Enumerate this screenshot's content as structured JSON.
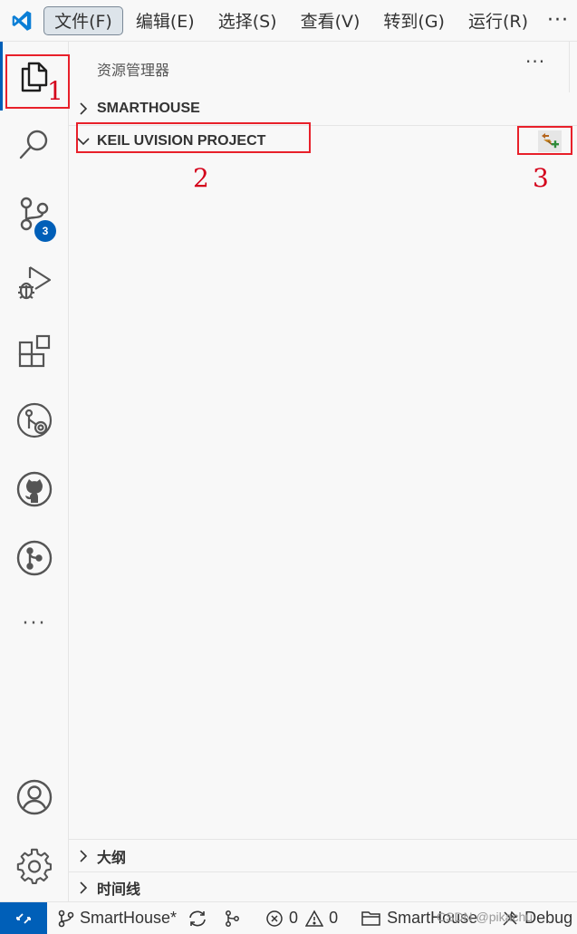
{
  "menubar": {
    "items": [
      {
        "label": "文件(F)",
        "active": true
      },
      {
        "label": "编辑(E)"
      },
      {
        "label": "选择(S)"
      },
      {
        "label": "查看(V)"
      },
      {
        "label": "转到(G)"
      },
      {
        "label": "运行(R)"
      }
    ],
    "more": "···"
  },
  "activitybar": {
    "items": [
      {
        "icon": "explorer-icon",
        "selected": true
      },
      {
        "icon": "search-icon"
      },
      {
        "icon": "source-control-icon",
        "badge": "3"
      },
      {
        "icon": "run-debug-icon"
      },
      {
        "icon": "extensions-icon"
      },
      {
        "icon": "git-graph-icon"
      },
      {
        "icon": "github-icon"
      },
      {
        "icon": "git-branch-icon"
      },
      {
        "icon": "more-icon"
      }
    ],
    "bottom": [
      {
        "icon": "account-icon"
      },
      {
        "icon": "settings-gear-icon"
      }
    ],
    "more_label": "···"
  },
  "sidebar": {
    "title": "资源管理器",
    "more": "···",
    "sections": [
      {
        "label": "SMARTHOUSE",
        "expanded": false
      },
      {
        "label": "KEIL UVISION PROJECT",
        "expanded": true
      },
      {
        "label": "大纲",
        "expanded": false
      },
      {
        "label": "时间线",
        "expanded": false
      }
    ]
  },
  "annotations": {
    "one": "1",
    "two": "2",
    "three": "3"
  },
  "statusbar": {
    "branch": "SmartHouse*",
    "errors": "0",
    "warnings": "0",
    "project": "SmartHouse",
    "target": "Debug",
    "watermark": "CSDN @pikachu"
  },
  "colors": {
    "accent": "#005fb8",
    "annotation_red": "#e8202a",
    "background": "#f8f8f8"
  }
}
